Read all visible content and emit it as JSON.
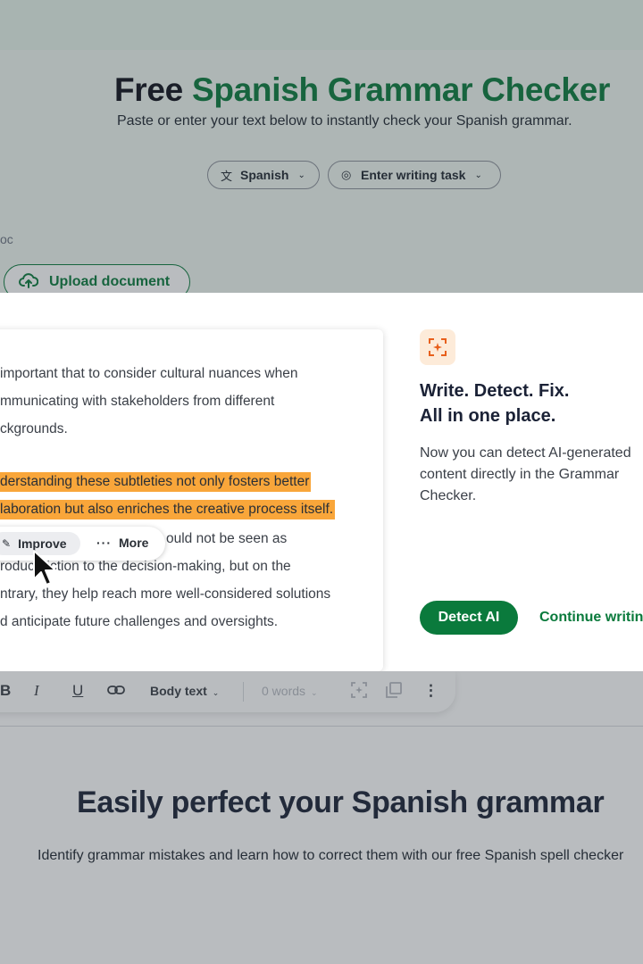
{
  "hero": {
    "title_part1": "Free",
    "title_part2": "Spanish Grammar Checker",
    "subtitle": "Paste or enter your text below to instantly check your Spanish grammar."
  },
  "controls": {
    "language": "Spanish",
    "writing_task": "Enter writing task",
    "doc_label": "oc",
    "upload_label": "Upload document"
  },
  "modal": {
    "preview_lines": [
      "important that to consider cultural nuances when",
      "mmunicating with stakeholders from different",
      "ckgrounds.",
      "derstanding these subtleties not only fosters better",
      "laboration but also enriches the creative process itself.",
      "ould not be seen as",
      "roduc  friction to the decision-making, but on the",
      "ntrary, they help reach more well-considered solutions",
      "d anticipate future challenges and oversights."
    ],
    "improve_label": "Improve",
    "more_label": "More",
    "title_line1": "Write. Detect. Fix.",
    "title_line2": "All in one place.",
    "description": "Now you can detect AI-generated content directly in the Grammar Checker.",
    "detect_button": "Detect AI",
    "continue_link": "Continue writing"
  },
  "toolbar": {
    "bold": "B",
    "italic": "I",
    "underline": "U",
    "text_style": "Body text",
    "word_count": "0 words"
  },
  "section": {
    "title": "Easily perfect your Spanish grammar",
    "subtitle": "Identify grammar mistakes and learn how to correct them with our free Spanish spell checker"
  },
  "colors": {
    "brand_green": "#0a7a3c",
    "highlight_orange": "#f9a63a",
    "icon_bg": "#fdebd9"
  }
}
